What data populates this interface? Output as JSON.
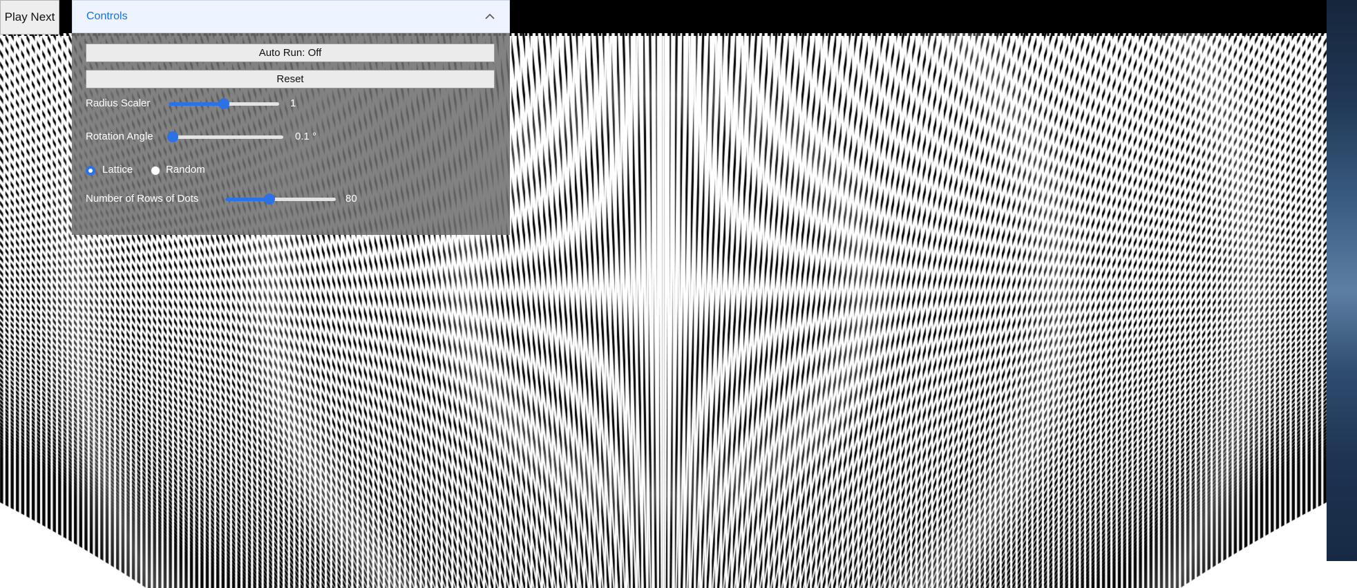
{
  "toolbar": {
    "play_next_label": "Play Next"
  },
  "controls": {
    "title": "Controls",
    "collapse_icon": "chevron-up-icon",
    "auto_run_label": "Auto Run: Off",
    "reset_label": "Reset",
    "radius_scaler": {
      "label": "Radius Scaler",
      "value_text": "1",
      "fraction": 0.5
    },
    "rotation_angle": {
      "label": "Rotation Angle",
      "value_text": "0.1 °",
      "fraction": 0.0
    },
    "layout_mode": {
      "options": [
        "Lattice",
        "Random"
      ],
      "selected": "Lattice"
    },
    "rows_of_dots": {
      "label": "Number of Rows of Dots",
      "value_text": "80",
      "fraction": 0.4
    }
  },
  "colors": {
    "accent": "#2a72e6",
    "canvas_foreground": "#000000",
    "canvas_background": "#ffffff"
  }
}
